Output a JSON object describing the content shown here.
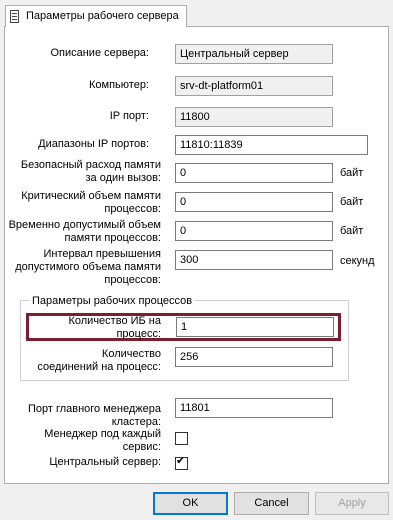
{
  "tab": {
    "label": "Параметры рабочего сервера",
    "icon": "document-icon"
  },
  "fields": {
    "description": {
      "label": "Описание сервера:",
      "value": "Центральный сервер"
    },
    "computer": {
      "label": "Компьютер:",
      "value": "srv-dt-platform01"
    },
    "ip_port": {
      "label": "IP порт:",
      "value": "11800"
    },
    "port_ranges": {
      "label": "Диапазоны IP портов:",
      "value": "11810:11839"
    },
    "safe_memory": {
      "label_line1": "Безопасный расход памяти",
      "label_line2": "за один вызов:",
      "value": "0",
      "unit": "байт"
    },
    "critical_memory": {
      "label_line1": "Критический объем памяти",
      "label_line2": "процессов:",
      "value": "0",
      "unit": "байт"
    },
    "temp_memory": {
      "label_line1": "Временно допустимый объем",
      "label_line2": "памяти процессов:",
      "value": "0",
      "unit": "байт"
    },
    "interval": {
      "label_line1": "Интервал превышения",
      "label_line2": "допустимого объема памяти",
      "label_line3": "процессов:",
      "value": "300",
      "unit": "секунд"
    }
  },
  "process_group": {
    "title": "Параметры рабочих процессов",
    "ib_per_process": {
      "label_line1": "Количество ИБ на",
      "label_line2": "процесс:",
      "value": "1"
    },
    "connections_per_process": {
      "label_line1": "Количество",
      "label_line2": "соединений на процесс:",
      "value": "256"
    }
  },
  "main_manager_port": {
    "label_line1": "Порт главного менеджера",
    "label_line2": "кластера:",
    "value": "11801"
  },
  "manager_per_service": {
    "label_line1": "Менеджер под каждый",
    "label_line2": "сервис:",
    "checked": false
  },
  "central_server": {
    "label": "Центральный сервер:",
    "checked": true,
    "mark": "✔"
  },
  "buttons": {
    "ok": "OK",
    "cancel": "Cancel",
    "apply": "Apply"
  },
  "colors": {
    "highlight": "#7b1e2e",
    "default_button_border": "#0078d7"
  }
}
